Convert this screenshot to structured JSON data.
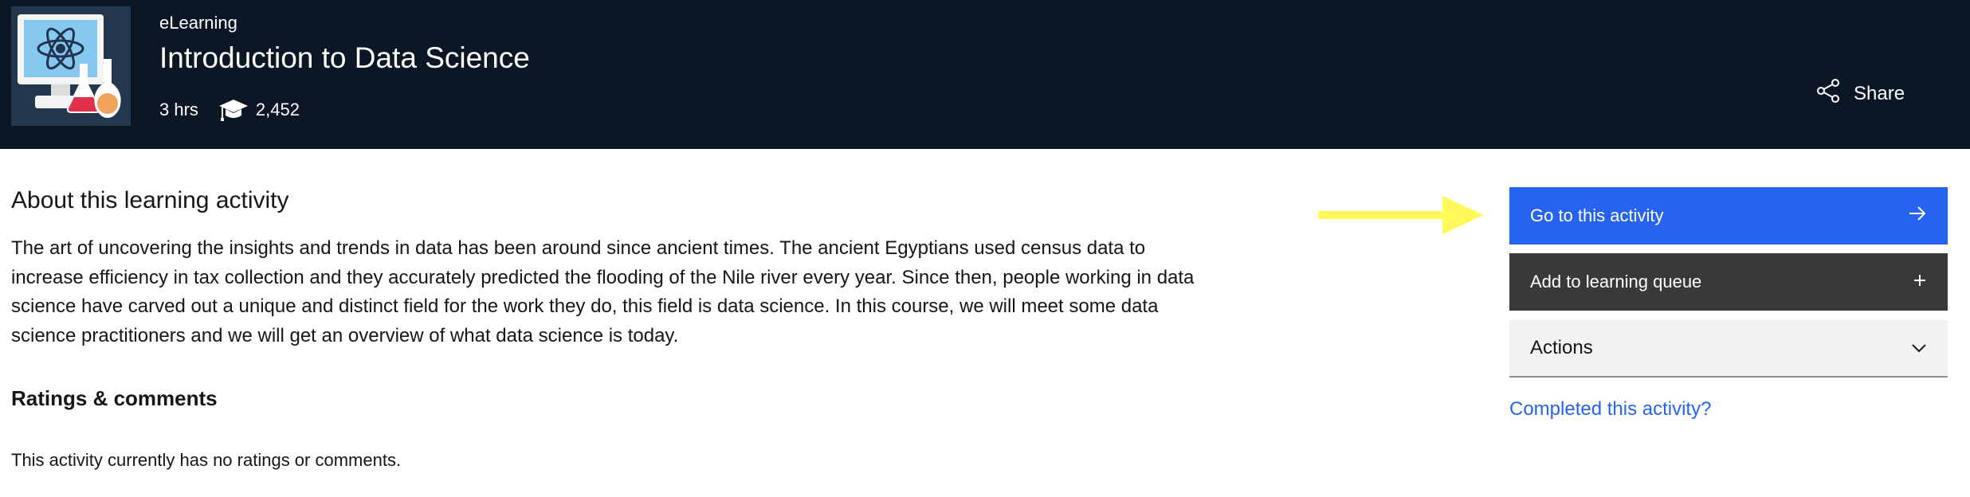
{
  "header": {
    "course_type": "eLearning",
    "title": "Introduction to Data Science",
    "duration": "3 hrs",
    "enrollments": "2,452",
    "share_label": "Share"
  },
  "about": {
    "heading": "About this learning activity",
    "description": "The art of uncovering the insights and trends in data has been around since ancient times. The ancient Egyptians used census data to increase efficiency in tax collection and they accurately predicted the flooding of the Nile river every year. Since then, people working in data science have carved out a unique and distinct field for the work they do, this field is data science. In this course, we will meet some data science practitioners and we will get an overview of what data science is today."
  },
  "ratings": {
    "heading": "Ratings & comments",
    "empty_text": "This activity currently has no ratings or comments."
  },
  "sidebar": {
    "go_label": "Go to this activity",
    "queue_label": "Add to learning queue",
    "actions_label": "Actions",
    "completed_link": "Completed this activity?"
  },
  "colors": {
    "hero_bg": "#0c1726",
    "primary_button": "#2563f0",
    "secondary_button": "#393939",
    "annotation_arrow": "#fff95a"
  },
  "icons": {
    "graduation": "graduation-cap-icon",
    "share": "share-icon",
    "go": "arrow-right-icon",
    "queue": "plus-icon",
    "actions": "chevron-down-icon"
  }
}
